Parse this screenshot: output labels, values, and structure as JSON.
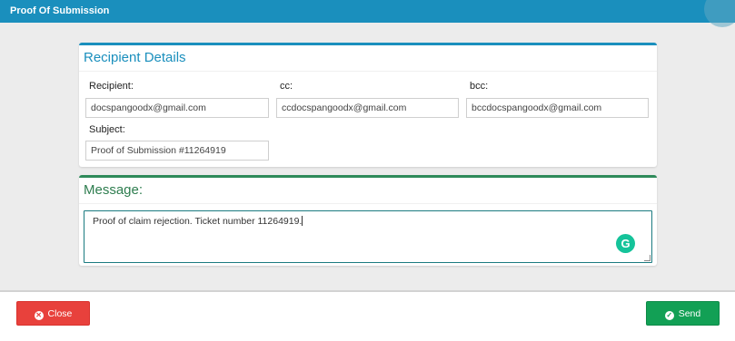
{
  "window": {
    "title": "Proof Of Submission"
  },
  "recipient_details": {
    "title": "Recipient Details",
    "recipient_label": "Recipient:",
    "recipient_value": "docspangoodx@gmail.com",
    "cc_label": "cc:",
    "cc_value": "ccdocspangoodx@gmail.com",
    "bcc_label": "bcc:",
    "bcc_value": "bccdocspangoodx@gmail.com",
    "subject_label": "Subject:",
    "subject_value": "Proof of Submission #11264919"
  },
  "message": {
    "title": "Message:",
    "body": "Proof of claim rejection. Ticket number 11264919."
  },
  "footer": {
    "close_label": "Close",
    "send_label": "Send"
  },
  "icons": {
    "close": "close-circle-icon",
    "send": "check-circle-icon",
    "grammarly": "grammarly-icon"
  },
  "colors": {
    "header": "#1a8fbd",
    "message_accent": "#2e8a5a",
    "close_button": "#e8413c",
    "send_button": "#12a055"
  }
}
